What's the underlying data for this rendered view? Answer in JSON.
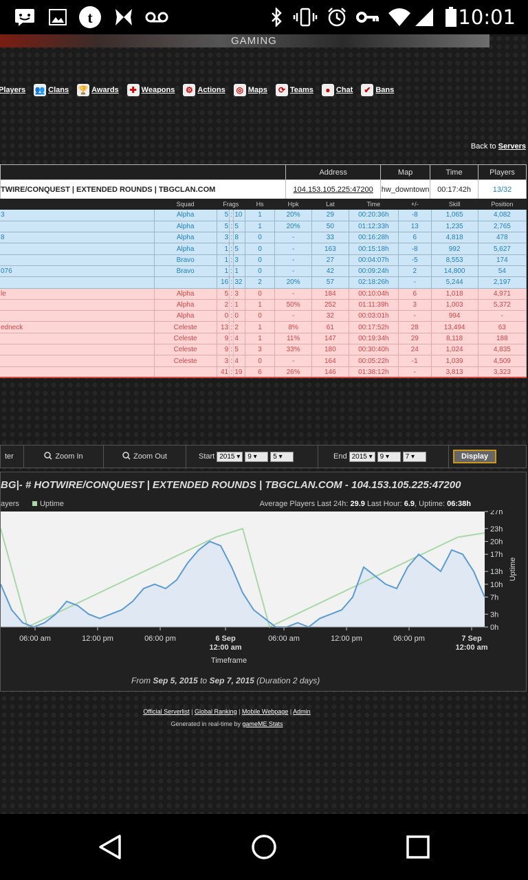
{
  "statusbar": {
    "time": "10:01"
  },
  "banner": {
    "text": "GAMING"
  },
  "nav": {
    "items": [
      {
        "label": "Players",
        "icon": "players-icon",
        "glyph": "👤"
      },
      {
        "label": "Clans",
        "icon": "clans-icon",
        "glyph": "👥"
      },
      {
        "label": "Awards",
        "icon": "trophy-icon",
        "glyph": "🏆"
      },
      {
        "label": "Weapons",
        "icon": "weapon-icon",
        "glyph": "✚"
      },
      {
        "label": "Actions",
        "icon": "wrench-icon",
        "glyph": "⚙"
      },
      {
        "label": "Maps",
        "icon": "target-icon",
        "glyph": "◎"
      },
      {
        "label": "Teams",
        "icon": "teams-icon",
        "glyph": "⟳"
      },
      {
        "label": "Chat",
        "icon": "chat-icon",
        "glyph": "●"
      },
      {
        "label": "Bans",
        "icon": "shield-icon",
        "glyph": "✔"
      }
    ]
  },
  "back": {
    "prefix": "Back to",
    "link": "Servers"
  },
  "server": {
    "headers": {
      "address": "Address",
      "map": "Map",
      "time": "Time",
      "players": "Players"
    },
    "name": "TWIRE/CONQUEST | EXTENDED ROUNDS | TBGCLAN.COM",
    "address": "104.153.105.225:47200",
    "map": "hw_downtown",
    "time": "00:17:42h",
    "players": "13/32"
  },
  "players": {
    "headers": [
      "Squad",
      "Frags",
      "Hs",
      "Hpk",
      "Lat",
      "Time",
      "+/-",
      "Skill",
      "Position"
    ],
    "blue_rows": [
      [
        "3",
        "Alpha",
        "5",
        "10",
        "1",
        "20%",
        "29",
        "00:20:36h",
        "-8",
        "1,065",
        "4,082"
      ],
      [
        "",
        "Alpha",
        "5",
        "5",
        "1",
        "20%",
        "50",
        "01:12:33h",
        "13",
        "1,235",
        "2,765"
      ],
      [
        "8",
        "Alpha",
        "3",
        "8",
        "0",
        "-",
        "33",
        "00:16:28h",
        "6",
        "4,818",
        "478"
      ],
      [
        "",
        "Alpha",
        "1",
        "5",
        "0",
        "-",
        "163",
        "00:15:18h",
        "-8",
        "992",
        "5,627"
      ],
      [
        "",
        "Bravo",
        "1",
        "3",
        "0",
        "-",
        "27",
        "00:04:07h",
        "-5",
        "8,553",
        "174"
      ],
      [
        "076",
        "Bravo",
        "1",
        "1",
        "0",
        "-",
        "42",
        "00:09:24h",
        "2",
        "14,800",
        "54"
      ]
    ],
    "blue_total": [
      "",
      "",
      "16",
      "32",
      "2",
      "20%",
      "57",
      "02:18:26h",
      "-",
      "5,244",
      "2,197"
    ],
    "red_rows": [
      [
        "le",
        "Alpha",
        "5",
        "3",
        "0",
        "-",
        "184",
        "00:10:04h",
        "6",
        "1,018",
        "4,971"
      ],
      [
        "",
        "Alpha",
        "2",
        "1",
        "1",
        "50%",
        "252",
        "01:11:39h",
        "3",
        "1,003",
        "5,372"
      ],
      [
        "",
        "Alpha",
        "0",
        "0",
        "0",
        "-",
        "32",
        "00:03:01h",
        "-",
        "994",
        "-"
      ],
      [
        "edneck",
        "Celeste",
        "13",
        "2",
        "1",
        "8%",
        "61",
        "00:17:52h",
        "28",
        "13,494",
        "63"
      ],
      [
        "",
        "Celeste",
        "9",
        "4",
        "1",
        "11%",
        "147",
        "00:19:34h",
        "29",
        "8,118",
        "188"
      ],
      [
        "",
        "Celeste",
        "9",
        "5",
        "3",
        "33%",
        "180",
        "00:30:40h",
        "24",
        "1,024",
        "4,835"
      ],
      [
        "",
        "Celeste",
        "3",
        "4",
        "0",
        "-",
        "164",
        "00:05:22h",
        "-1",
        "1,039",
        "4,509"
      ]
    ],
    "red_total": [
      "",
      "",
      "41",
      "19",
      "6",
      "26%",
      "146",
      "01:38:12h",
      "-",
      "3,813",
      "3,323"
    ]
  },
  "toolbar": {
    "filter": "ter",
    "zoom_in": "Zoom In",
    "zoom_out": "Zoom Out",
    "start_label": "Start",
    "start": [
      "2015",
      "9",
      "5"
    ],
    "end_label": "End",
    "end": [
      "2015",
      "9",
      "7"
    ],
    "display": "Display"
  },
  "graph": {
    "title": "BG|- # HOTWIRE/CONQUEST | EXTENDED ROUNDS | TBGCLAN.COM - 104.153.105.225:47200",
    "legend_players": "ayers",
    "legend_uptime": "Uptime",
    "avg_label": "Average Players Last 24h:",
    "avg_24h": "29.9",
    "last_hour_label": "Last Hour:",
    "last_hour": "6.9",
    "uptime_label": "Uptime:",
    "uptime": "06:38h",
    "xaxis_title": "Timeframe",
    "yaxis_title": "Uptime",
    "range_from_label": "From",
    "range_from": "Sep 5, 2015",
    "range_to_label": "to",
    "range_to": "Sep 7, 2015",
    "range_duration": "(Duration 2 days)",
    "colors": {
      "players": "#5a9bd4",
      "uptime": "#a8d8a8",
      "plotbg": "#f2f2f2"
    }
  },
  "chart_data": {
    "type": "line",
    "x_ticks": [
      "06:00 am",
      "12:00 pm",
      "06:00 pm",
      "6 Sep\n12:00 am",
      "06:00 am",
      "12:00 pm",
      "06:00 pm",
      "7 Sep\n12:00 am"
    ],
    "y_ticks": [
      "0h",
      "3h",
      "7h",
      "10h",
      "13h",
      "17h",
      "20h",
      "23h",
      "27h"
    ],
    "ylabel": "Uptime",
    "xlabel": "Timeframe",
    "series": [
      {
        "name": "ayers",
        "values": [
          10,
          4,
          1,
          0,
          1,
          3,
          6,
          5,
          3,
          2,
          3,
          4,
          6,
          9,
          10,
          9,
          11,
          15,
          18,
          20,
          19,
          14,
          8,
          4,
          2,
          0,
          0,
          1,
          0,
          2,
          3,
          4,
          7,
          14,
          12,
          10,
          9,
          14,
          17,
          15,
          13,
          18,
          17,
          13,
          7
        ]
      },
      {
        "name": "Uptime",
        "values": [
          23,
          0,
          3,
          6,
          9,
          12,
          15,
          18,
          21,
          23,
          0,
          3,
          6,
          9,
          12,
          15,
          18,
          21,
          22
        ]
      }
    ]
  }
}
